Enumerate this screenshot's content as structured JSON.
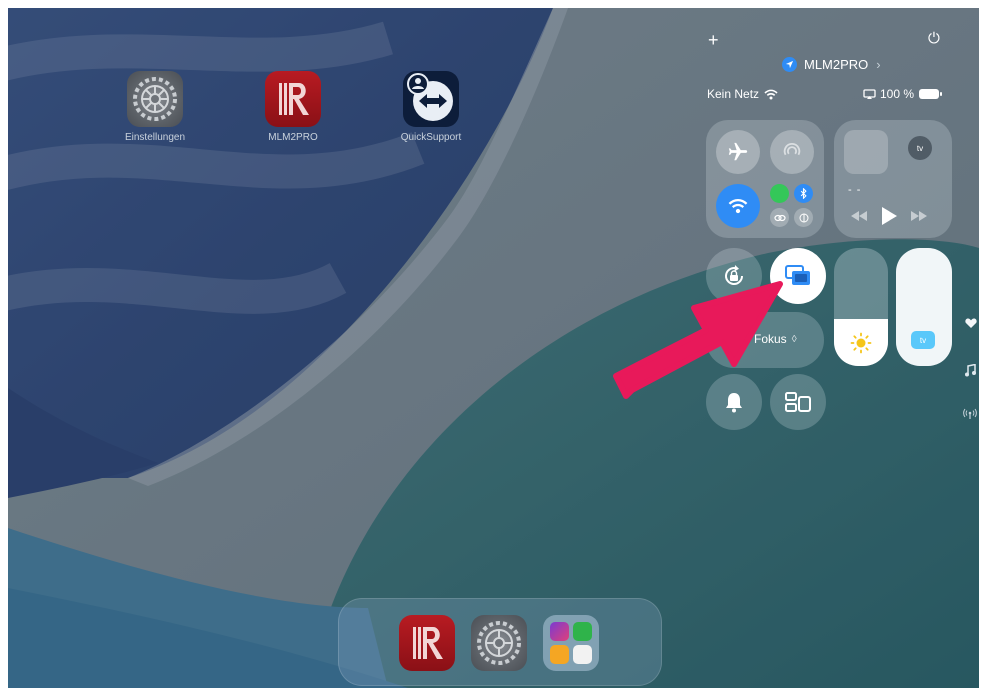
{
  "home": {
    "apps": [
      {
        "name": "Einstellungen"
      },
      {
        "name": "MLM2PRO"
      },
      {
        "name": "QuickSupport"
      }
    ]
  },
  "control_center": {
    "add_symbol": "+",
    "power_symbol": "⏻",
    "app_name": "MLM2PRO",
    "app_chevron": "›",
    "network_status": "Kein Netz",
    "battery_text": "100 %",
    "media": {
      "dashes": "- -",
      "appletv_badge": "tv"
    },
    "focus_label": "Fokus",
    "focus_chevron": "◊",
    "appletv_slider_badge": "tv",
    "brightness_level": 0.4,
    "volume_level": 1.0
  },
  "colors": {
    "accent_blue": "#2f8cf5",
    "annotation_arrow": "#e8195a",
    "active_green": "#34c759"
  }
}
